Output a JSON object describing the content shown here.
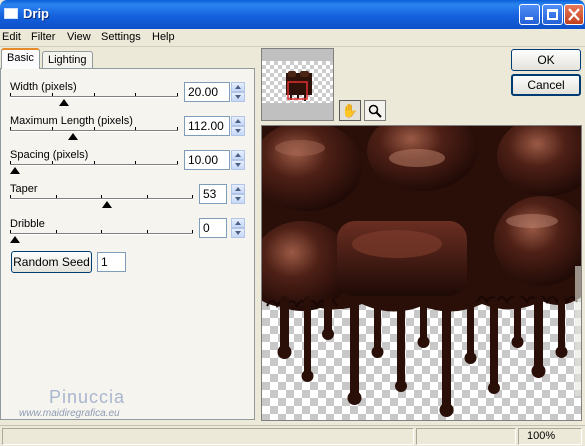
{
  "window": {
    "title": "Drip"
  },
  "menu": [
    "Edit",
    "Filter",
    "View",
    "Settings",
    "Help"
  ],
  "tabs": [
    {
      "label": "Basic",
      "active": true
    },
    {
      "label": "Lighting",
      "active": false
    }
  ],
  "parameters": [
    {
      "label": "Width (pixels)",
      "value": "20.00",
      "level": 0.31
    },
    {
      "label": "Maximum Length (pixels)",
      "value": "112.00",
      "level": 0.37
    },
    {
      "label": "Spacing (pixels)",
      "value": "10.00",
      "level": 0.0
    },
    {
      "label": "Taper",
      "value": "53",
      "level": 0.53
    },
    {
      "label": "Dribble",
      "value": "0",
      "level": 0.0
    }
  ],
  "random_seed": {
    "button_label": "Random Seed",
    "value": "1"
  },
  "buttons": {
    "ok": "OK",
    "cancel": "Cancel"
  },
  "watermark": {
    "name": "Pinuccia",
    "url": "www.maidiregrafica.eu"
  },
  "tools": [
    {
      "icon": "hand-icon",
      "glyph": "✋",
      "pressed": true
    },
    {
      "icon": "zoom-icon",
      "glyph": "🔍",
      "pressed": false
    }
  ],
  "status": {
    "zoom": "100%"
  },
  "colors": {
    "title_bar": "#0d4fc7",
    "chocolate": "#3a1a10",
    "checker_light": "#ffffff",
    "checker_dark": "#c8c8c8",
    "selection_box": "#e03030"
  }
}
